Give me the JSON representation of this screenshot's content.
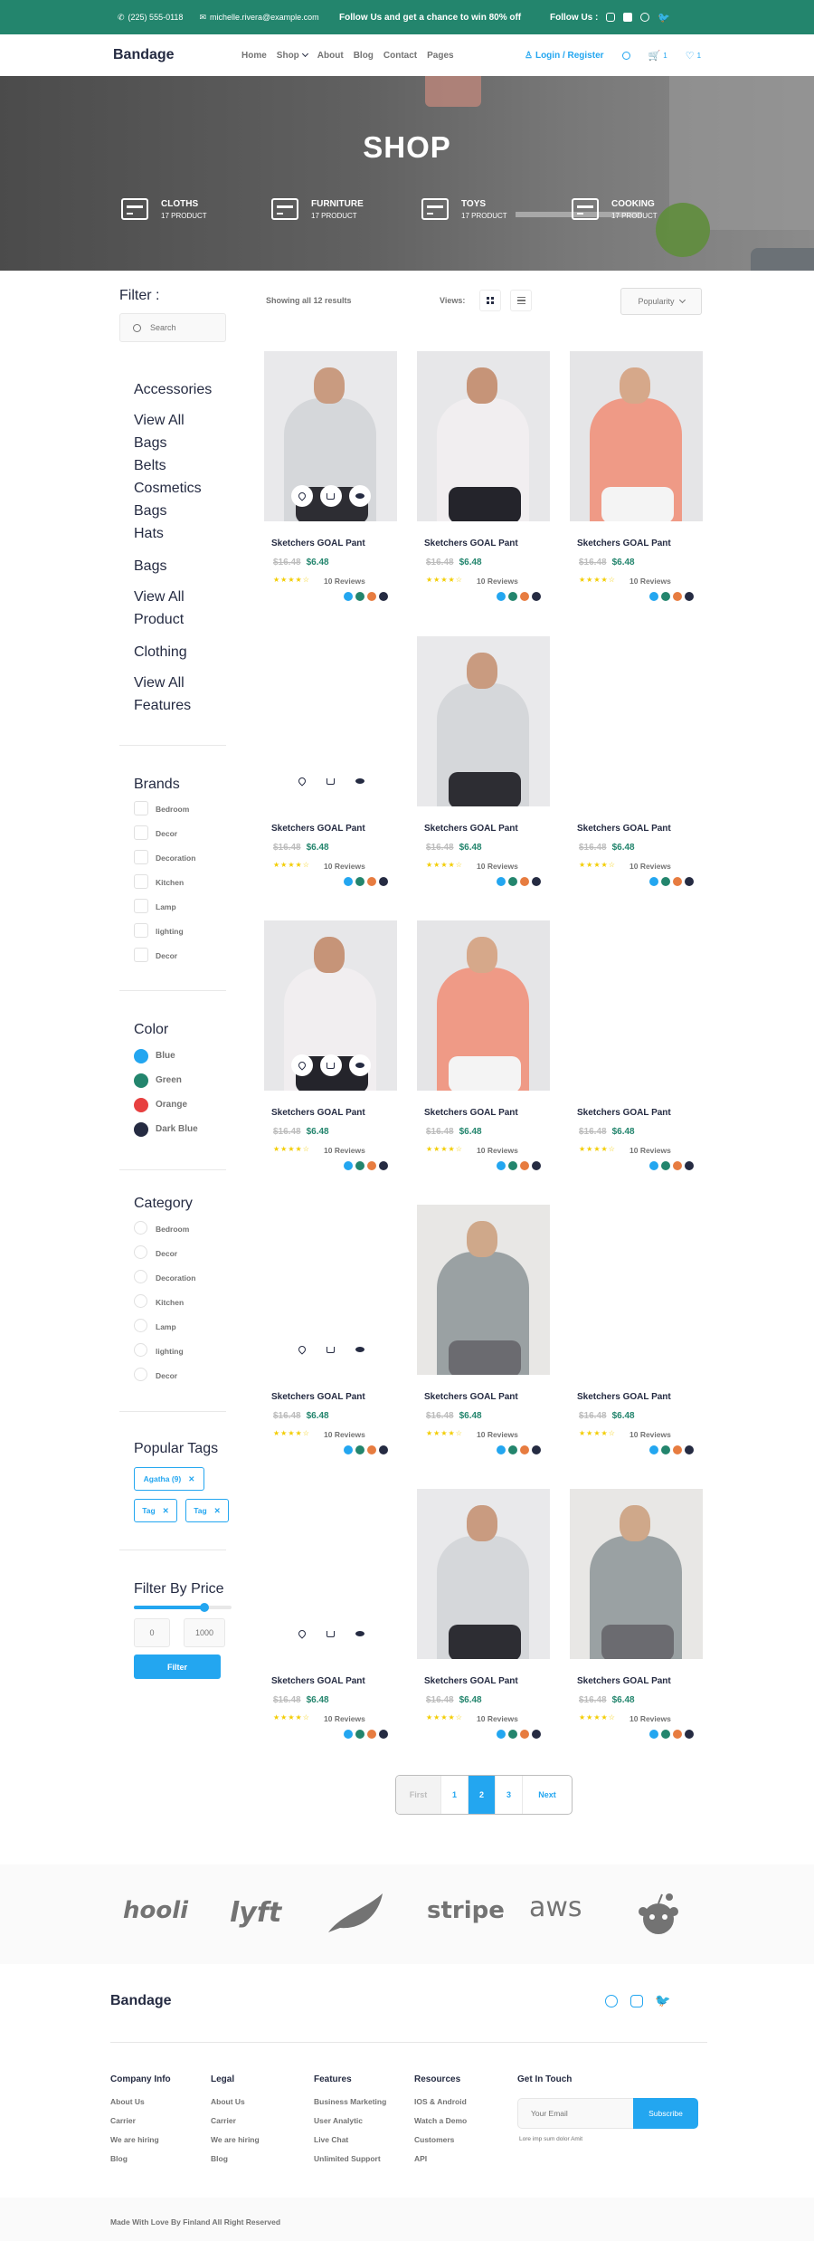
{
  "topbar": {
    "phone": "(225) 555-0118",
    "email": "michelle.rivera@example.com",
    "promo": "Follow Us  and get a chance to win 80% off",
    "follow": "Follow Us :",
    "social_icons": [
      "instagram-icon",
      "youtube-icon",
      "facebook-icon",
      "twitter-icon"
    ]
  },
  "nav": {
    "brand": "Bandage",
    "menu": [
      "Home",
      "Shop",
      "About",
      "Blog",
      "Contact",
      "Pages"
    ],
    "login": "Login / Register",
    "cart_count": "1",
    "wishlist_count": "1"
  },
  "hero": {
    "title": "SHOP",
    "categories": [
      {
        "name": "CLOTHS",
        "count": "17 PRODUCT"
      },
      {
        "name": "FURNITURE",
        "count": "17 PRODUCT"
      },
      {
        "name": "TOYS",
        "count": "17 PRODUCT"
      },
      {
        "name": "COOKING",
        "count": "17 PRODUCT"
      }
    ]
  },
  "sidebar": {
    "filter_label": "Filter :",
    "search_placeholder": "Search",
    "groups": [
      {
        "title": "Accessories",
        "links": [
          "View All",
          "Bags",
          "Belts",
          "Cosmetics",
          "Bags",
          "Hats"
        ]
      },
      {
        "title": "Bags",
        "links": [
          "View All",
          "Product"
        ]
      },
      {
        "title": "Clothing",
        "links": [
          "View All",
          "Features"
        ]
      }
    ],
    "brands_title": "Brands",
    "brands": [
      "Bedroom",
      "Decor",
      "Decoration",
      "Kitchen",
      "Lamp",
      "lighting",
      "Decor"
    ],
    "color_title": "Color",
    "colors": [
      {
        "name": "Blue",
        "hex": "#23a6f0"
      },
      {
        "name": "Green",
        "hex": "#23856d"
      },
      {
        "name": "Orange",
        "hex": "#e74040"
      },
      {
        "name": "Dark Blue",
        "hex": "#252b42"
      }
    ],
    "category_title": "Category",
    "categories": [
      "Bedroom",
      "Decor",
      "Decoration",
      "Kitchen",
      "Lamp",
      "lighting",
      "Decor"
    ],
    "tags_title": "Popular Tags",
    "tags": [
      "Agatha (9)",
      "Tag",
      "Tag"
    ],
    "price_title": "Filter By Price",
    "price_min": "0",
    "price_max": "1000",
    "price_slider_fraction": 0.72,
    "filter_button": "Filter"
  },
  "toolbar": {
    "count": "Showing all 12 results",
    "views": "Views:",
    "sort": "Popularity"
  },
  "product": {
    "name": "Sketchers GOAL Pant",
    "old_price": "$16.48",
    "new_price": "$6.48",
    "stars": "★★★★☆",
    "reviews": "10 Reviews",
    "swatches": [
      "#23a6f0",
      "#23856d",
      "#e77c40",
      "#252b42"
    ]
  },
  "pagination": {
    "first": "First",
    "pages": [
      "1",
      "2",
      "3"
    ],
    "current": "2",
    "next": "Next"
  },
  "logos": [
    "hooli",
    "lyft",
    "stripe",
    "aws"
  ],
  "footer": {
    "brand": "Bandage",
    "columns": [
      {
        "title": "Company Info",
        "links": [
          "About Us",
          "Carrier",
          "We are hiring",
          "Blog"
        ]
      },
      {
        "title": "Legal",
        "links": [
          "About Us",
          "Carrier",
          "We are hiring",
          "Blog"
        ]
      },
      {
        "title": "Features",
        "links": [
          "Business Marketing",
          "User Analytic",
          "Live Chat",
          "Unlimited Support"
        ]
      },
      {
        "title": "Resources",
        "links": [
          "IOS & Android",
          "Watch a Demo",
          "Customers",
          "API"
        ]
      }
    ],
    "contact_title": "Get In Touch",
    "email_placeholder": "Your Email",
    "subscribe": "Subscribe",
    "note": "Lore imp sum dolor Amit",
    "copyright": "Made With Love By Finland All Right Reserved"
  }
}
